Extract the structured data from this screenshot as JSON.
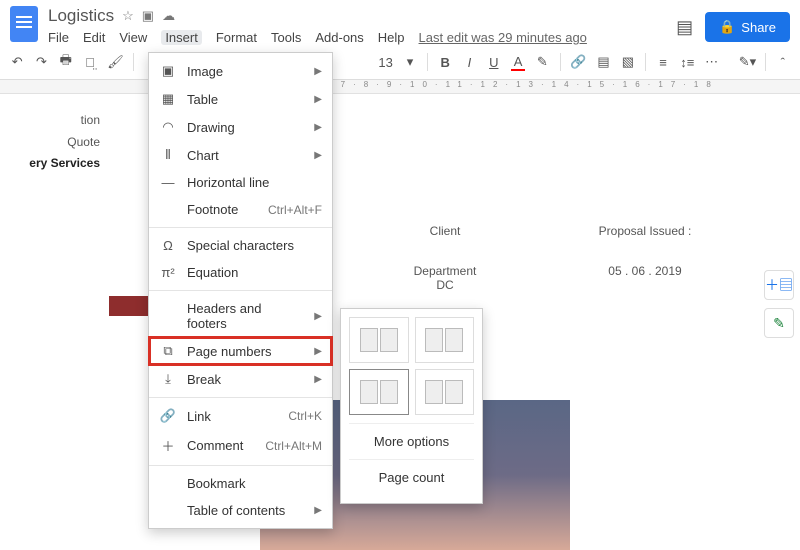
{
  "header": {
    "title": "Logistics",
    "menu": [
      "File",
      "Edit",
      "View",
      "Insert",
      "Format",
      "Tools",
      "Add-ons",
      "Help"
    ],
    "active_menu_index": 3,
    "last_edit": "Last edit was 29 minutes ago",
    "share": "Share"
  },
  "toolbar": {
    "font_size": "13",
    "bold": "B",
    "italic": "I",
    "underline": "U",
    "fontcolor": "A"
  },
  "outline": {
    "items": [
      "tion",
      "Quote",
      "ery Services"
    ]
  },
  "dropdown": {
    "items": [
      {
        "icon": "▣",
        "label": "Image",
        "arrow": true
      },
      {
        "icon": "▦",
        "label": "Table",
        "arrow": true
      },
      {
        "icon": "◠",
        "label": "Drawing",
        "arrow": true
      },
      {
        "icon": "⫴",
        "label": "Chart",
        "arrow": true
      },
      {
        "icon": "—",
        "label": "Horizontal line"
      },
      {
        "icon": "",
        "label": "Footnote",
        "shortcut": "Ctrl+Alt+F"
      },
      {
        "sep": true
      },
      {
        "icon": "Ω",
        "label": "Special characters"
      },
      {
        "icon": "π²",
        "label": "Equation"
      },
      {
        "sep": true
      },
      {
        "icon": "",
        "label": "Headers and footers",
        "arrow": true
      },
      {
        "icon": "⧉",
        "label": "Page numbers",
        "arrow": true,
        "highlight": true
      },
      {
        "icon": "⤓",
        "label": "Break",
        "arrow": true
      },
      {
        "sep": true
      },
      {
        "icon": "🔗",
        "label": "Link",
        "shortcut": "Ctrl+K"
      },
      {
        "icon": "＋",
        "label": "Comment",
        "shortcut": "Ctrl+Alt+M"
      },
      {
        "sep": true
      },
      {
        "icon": "",
        "label": "Bookmark"
      },
      {
        "icon": "",
        "label": "Table of contents",
        "arrow": true
      }
    ]
  },
  "submenu": {
    "more_options": "More options",
    "page_count": "Page count"
  },
  "document": {
    "client_label": "Client",
    "client_line1": "Department",
    "client_line2": "DC",
    "issued_label": "Proposal Issued :",
    "issued_date": "05 . 06 . 2019"
  }
}
